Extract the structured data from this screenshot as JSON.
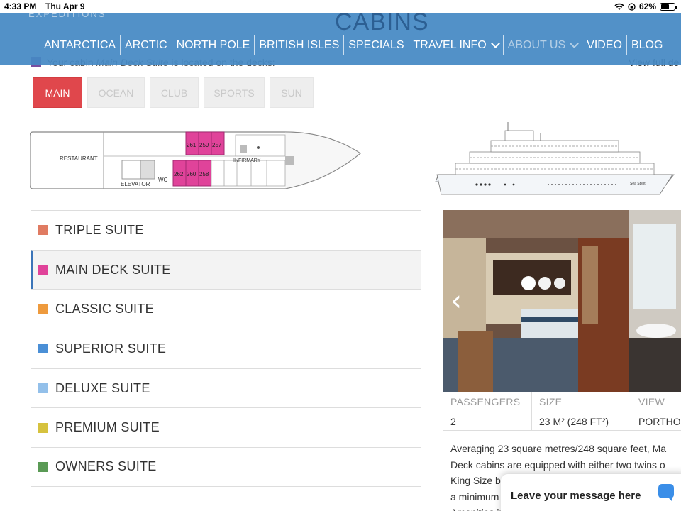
{
  "status_bar": {
    "time": "4:33 PM",
    "date": "Thu Apr 9",
    "battery": "62%",
    "battery_level": 0.62
  },
  "header": {
    "logo_text": "EXPEDITIONS",
    "page_title": "CABINS"
  },
  "nav": {
    "items": [
      {
        "label": "ANTARCTICA"
      },
      {
        "label": "ARCTIC"
      },
      {
        "label": "NORTH POLE"
      },
      {
        "label": "BRITISH ISLES"
      },
      {
        "label": "SPECIALS"
      },
      {
        "label": "TRAVEL INFO",
        "dropdown": true
      },
      {
        "label": "ABOUT US",
        "dropdown": true,
        "active": true
      },
      {
        "label": "VIDEO"
      },
      {
        "label": "BLOG"
      }
    ]
  },
  "deck_info": {
    "prefix": "Your cabin",
    "cabin_name": "Main Deck Suite",
    "suffix": "is located on the decks:",
    "view_full": "View full de",
    "marker_color": "#7a4fa0"
  },
  "deck_tabs": [
    {
      "label": "MAIN",
      "active": true
    },
    {
      "label": "OCEAN"
    },
    {
      "label": "CLUB"
    },
    {
      "label": "SPORTS"
    },
    {
      "label": "SUN"
    }
  ],
  "deck_plan": {
    "labels": {
      "restaurant": "RESTAURANT",
      "elevator": "ELEVATOR",
      "wc": "WC",
      "infirmary": "INFIRMARY"
    },
    "top_cabins": [
      "261",
      "259",
      "257"
    ],
    "bottom_cabins": [
      "262",
      "260",
      "258"
    ],
    "highlight_color": "#e0439a"
  },
  "ship_profile": {
    "name_text": "Sea Spirit"
  },
  "suites": [
    {
      "name": "TRIPLE SUITE",
      "color": "#e07b62"
    },
    {
      "name": "MAIN DECK SUITE",
      "color": "#e0439a",
      "selected": true
    },
    {
      "name": "CLASSIC SUITE",
      "color": "#ee9a3d"
    },
    {
      "name": "SUPERIOR SUITE",
      "color": "#4a8fd6"
    },
    {
      "name": "DELUXE SUITE",
      "color": "#93c0ea"
    },
    {
      "name": "PREMIUM SUITE",
      "color": "#d6c23e"
    },
    {
      "name": "OWNERS SUITE",
      "color": "#5a9a55"
    }
  ],
  "gallery": {
    "prev_icon": "‹"
  },
  "specs": [
    {
      "label": "PASSENGERS",
      "value": "2"
    },
    {
      "label": "SIZE",
      "value": "23 M² (248 FT²)"
    },
    {
      "label": "VIEW",
      "value": "PORTHO"
    }
  ],
  "description_lines": [
    "Averaging 23 square metres/248 square feet, Ma",
    "Deck cabins are equipped with either two twins o",
    "King Size b",
    "a minimum",
    "Amenities include: en-suite facilities, in-room sa"
  ],
  "chat": {
    "label": "Leave your message here"
  }
}
